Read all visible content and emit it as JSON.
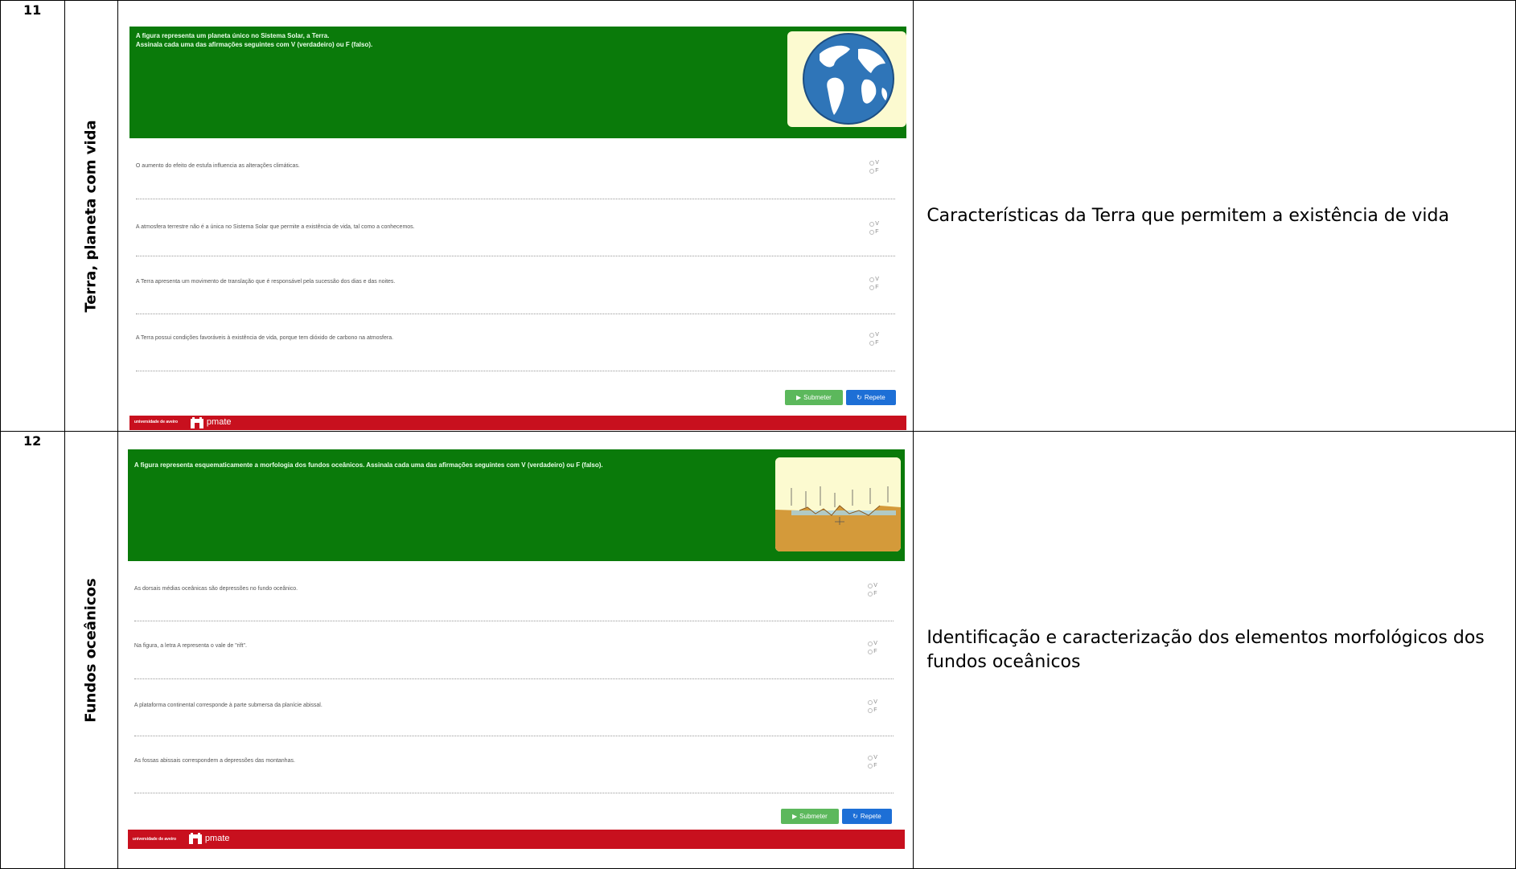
{
  "rows": [
    {
      "number": "11",
      "topic": "Terra, planeta com vida",
      "description": "Características da Terra que permitem a existência de vida",
      "widget": {
        "prompt_line1": "A figura representa um planeta único no Sistema Solar, a Terra.",
        "prompt_line2": "Assinala cada uma das afirmações seguintes com V (verdadeiro) ou F (falso).",
        "image_icon": "earth-globe",
        "questions": [
          "O aumento do efeito de estufa influencia as alterações climáticas.",
          "A atmosfera terrestre não é a única no Sistema Solar que permite a existência de vida, tal como a conhecemos.",
          "A Terra apresenta um movimento de translação que é responsável pela sucessão dos dias e das noites.",
          "A Terra possui condições favoráveis à existência de vida, porque tem dióxido de carbono na atmosfera."
        ],
        "option_v": "V",
        "option_f": "F",
        "submit_label": "Submeter",
        "repeat_label": "Repete",
        "footer_university": "universidade de aveiro",
        "footer_brand": "pmate"
      }
    },
    {
      "number": "12",
      "topic": "Fundos oceânicos",
      "description": "Identificação e caracterização dos elementos morfológicos dos fundos oceânicos",
      "widget": {
        "prompt_line1": "A figura representa esquematicamente a morfologia dos fundos oceânicos. Assinala cada uma das afirmações seguintes com V (verdadeiro) ou F (falso).",
        "image_icon": "ocean-floor-diagram",
        "questions": [
          "As dorsais médias oceânicas são depressões no fundo oceânico.",
          "Na figura, a letra A representa o vale de \"rift\".",
          "A plataforma continental corresponde à parte submersa da planície abissal.",
          "As fossas abissais correspondem a depressões das montanhas."
        ],
        "option_v": "V",
        "option_f": "F",
        "submit_label": "Submeter",
        "repeat_label": "Repete",
        "footer_university": "universidade de aveiro",
        "footer_brand": "pmate"
      }
    }
  ],
  "colors": {
    "banner_green": "#0a7a0a",
    "footer_red": "#c8101e",
    "submit_green": "#5cb85c",
    "repeat_blue": "#1d6fd6",
    "image_bg": "#fcfad0"
  }
}
